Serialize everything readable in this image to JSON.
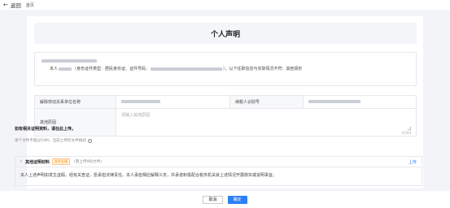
{
  "topbar": {
    "back_label": "返回",
    "crumb": "首页"
  },
  "card": {
    "title": "个人声明",
    "statement": {
      "prefix": "本人",
      "id_type_text": "（身份证件类型：居民身份证、证件号码：",
      "suffix": "），以下任职信息与实际情况不符：其他情形"
    },
    "table": {
      "employer_label": "解除劳动关系单位名称",
      "taxpayer_label": "纳税人识别号",
      "reason_label": "其他原因",
      "reason_placeholder": "请输入其他原因",
      "char_count": "0/300"
    },
    "upload_note": "如有相关证明资料，请在此上传。",
    "size_hint": "单个文件不超过10M，当前上传的文件格式",
    "attachment": {
      "name": "其他证明材料",
      "tag": "条件必填",
      "hint": "(限上传9份文件)",
      "upload_label": "上传"
    },
    "promise_text": "本人上述声明如发生虚假，经有关查证，愿承担法律责任。本人承担相应解释义务，并承诺积极配合税务机关就上述情况开展核实或说明事宜。"
  },
  "footer": {
    "cancel_label": "取消",
    "confirm_label": "确定"
  },
  "colors": {
    "primary": "#2d7ff9",
    "tag_orange": "#ff8a00",
    "panel_bg": "#f3f5f9"
  }
}
